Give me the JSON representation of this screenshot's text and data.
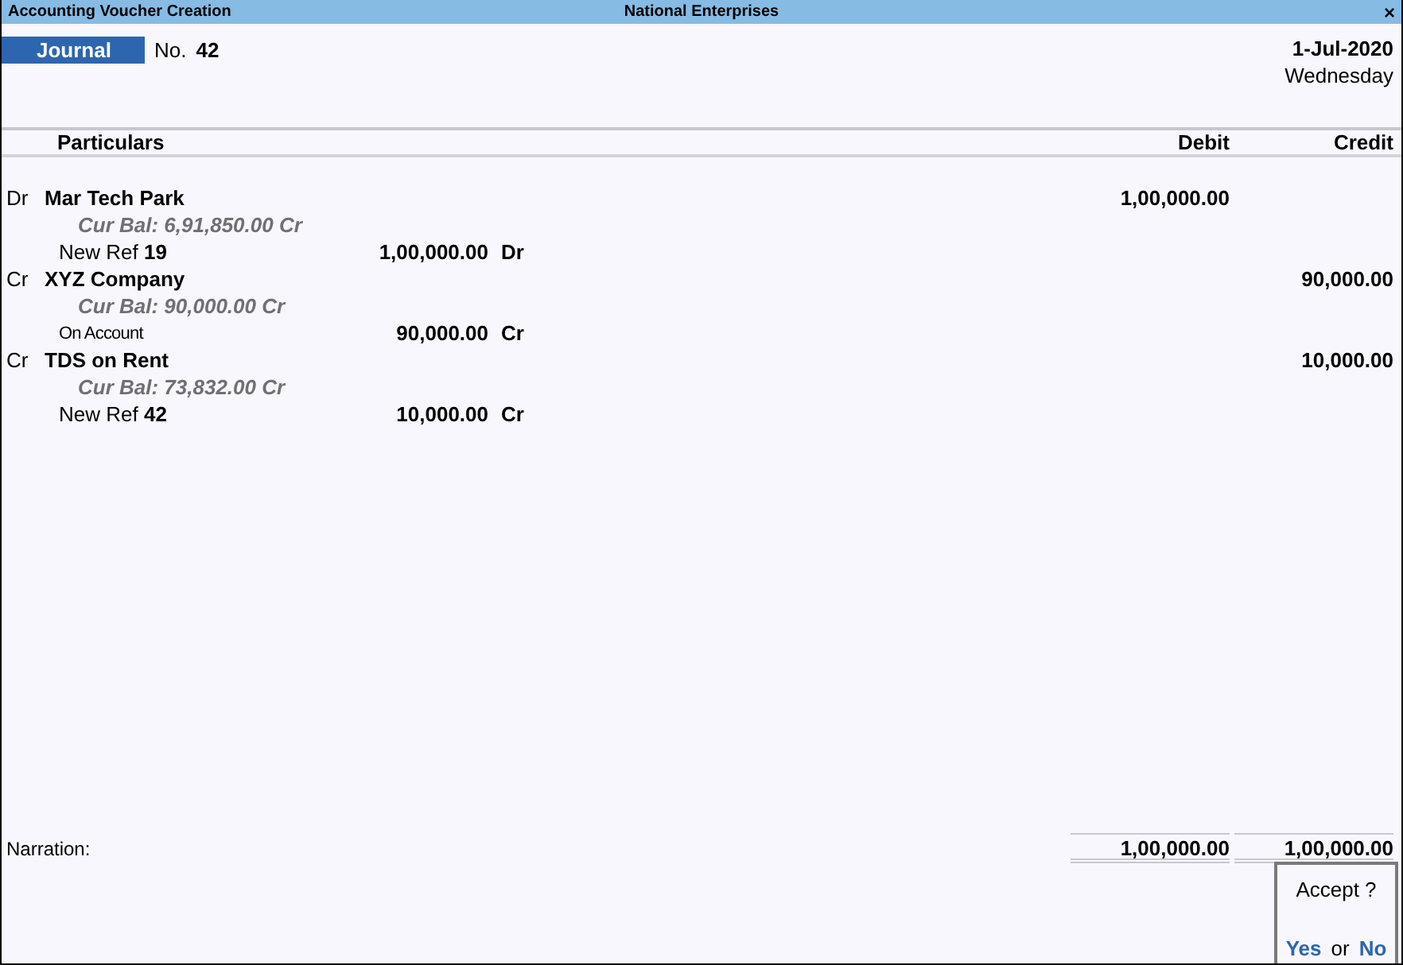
{
  "window": {
    "title": "Accounting Voucher  Creation",
    "company": "National Enterprises",
    "close": "×"
  },
  "voucher": {
    "type": "Journal",
    "number_label": "No.",
    "number": "42",
    "date": "1-Jul-2020",
    "day": "Wednesday"
  },
  "columns": {
    "particulars": "Particulars",
    "debit": "Debit",
    "credit": "Credit"
  },
  "entries": [
    {
      "dc": "Dr",
      "ledger": "Mar Tech Park",
      "cur_bal": "Cur Bal:  6,91,850.00 Cr",
      "debit": "1,00,000.00",
      "bill": {
        "kind": "new_ref",
        "label": "New Ref",
        "ref": "19",
        "amount": "1,00,000.00",
        "dc": "Dr"
      }
    },
    {
      "dc": "Cr",
      "ledger": "XYZ Company",
      "cur_bal": "Cur Bal:  90,000.00 Cr",
      "credit": "90,000.00",
      "bill": {
        "kind": "on_account",
        "label": "On Account",
        "amount": "90,000.00",
        "dc": "Cr"
      }
    },
    {
      "dc": "Cr",
      "ledger": "TDS on Rent",
      "cur_bal": "Cur Bal:  73,832.00 Cr",
      "credit": "10,000.00",
      "bill": {
        "kind": "new_ref",
        "label": "New Ref",
        "ref": "42",
        "amount": "10,000.00",
        "dc": "Cr"
      }
    }
  ],
  "narration": {
    "label": "Narration:"
  },
  "totals": {
    "debit": "1,00,000.00",
    "credit": "1,00,000.00"
  },
  "dialog": {
    "question": "Accept ?",
    "yes": "Yes",
    "or": "or",
    "no": "No"
  }
}
